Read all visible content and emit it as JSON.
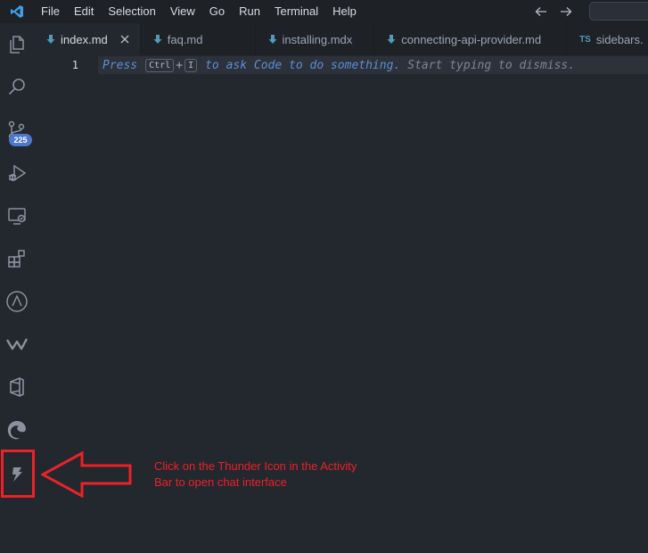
{
  "menu": {
    "items": [
      "File",
      "Edit",
      "Selection",
      "View",
      "Go",
      "Run",
      "Terminal",
      "Help"
    ]
  },
  "activity_bar": {
    "icons": [
      "explorer-icon",
      "search-icon",
      "source-control-icon",
      "run-debug-icon",
      "remote-explorer-icon",
      "extensions-icon",
      "arc-icon",
      "w-logo-icon",
      "office-icon",
      "edge-icon",
      "thunder-icon"
    ],
    "source_control_badge": "225"
  },
  "tabs": [
    {
      "label": "index.md",
      "icon": "markdown-icon",
      "active": true
    },
    {
      "label": "faq.md",
      "icon": "markdown-icon",
      "active": false
    },
    {
      "label": "installing.mdx",
      "icon": "markdown-icon",
      "active": false
    },
    {
      "label": "connecting-api-provider.md",
      "icon": "markdown-icon",
      "active": false
    },
    {
      "label": "sidebars.",
      "icon_text": "TS",
      "active": false
    }
  ],
  "editor": {
    "line_number": "1",
    "hint_press": "Press",
    "hint_key1": "Ctrl",
    "hint_plus": "+",
    "hint_key2": "I",
    "hint_action": "to ask Code to do something.",
    "hint_dismiss": "Start typing to dismiss."
  },
  "annotation": {
    "text": "Click on the Thunder Icon in the Activity Bar to open chat interface",
    "color": "#e8232a"
  },
  "colors": {
    "accent": "#4d78cc",
    "markdown_icon": "#519aba",
    "editor_bg": "#23272e"
  }
}
